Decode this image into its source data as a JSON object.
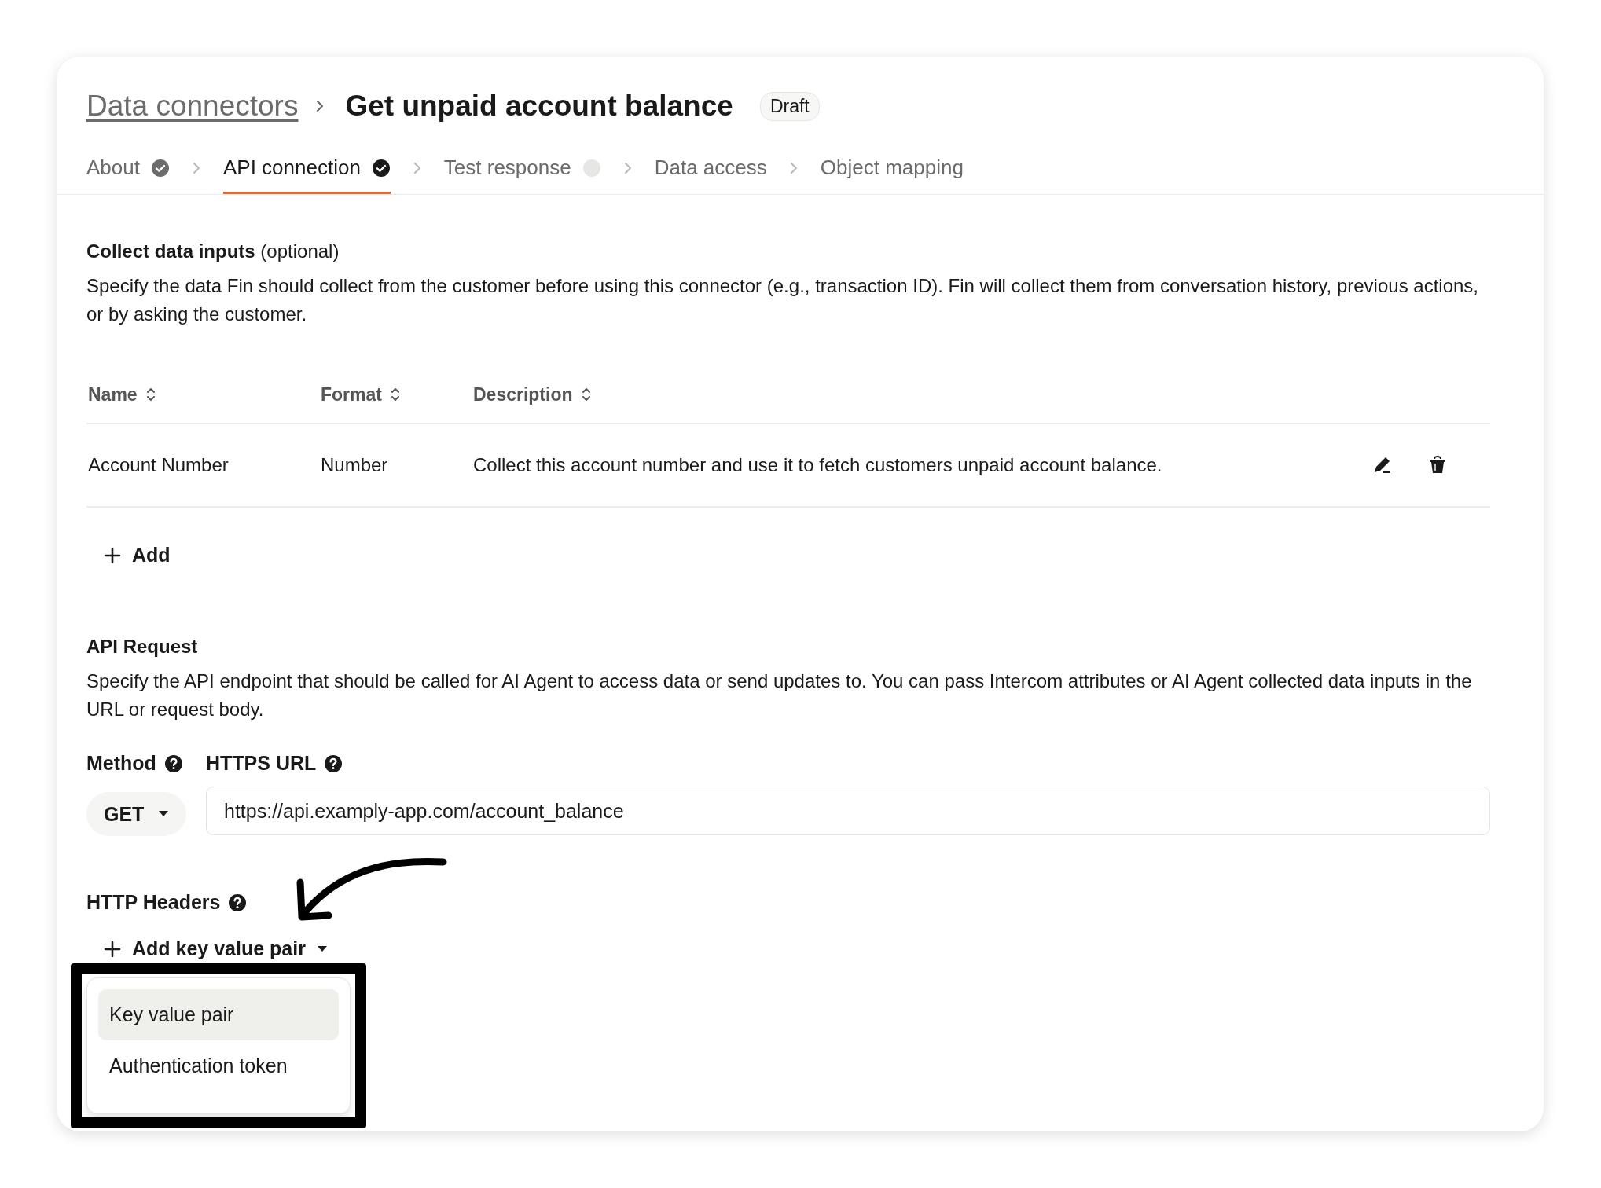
{
  "breadcrumb": {
    "link": "Data connectors",
    "title": "Get unpaid account balance",
    "badge": "Draft"
  },
  "tabs": [
    {
      "label": "About",
      "selected": false,
      "completed": true,
      "pending": false
    },
    {
      "label": "API connection",
      "selected": true,
      "completed": true,
      "pending": false
    },
    {
      "label": "Test response",
      "selected": false,
      "completed": false,
      "pending": true
    },
    {
      "label": "Data access",
      "selected": false,
      "completed": false,
      "pending": false
    },
    {
      "label": "Object mapping",
      "selected": false,
      "completed": false,
      "pending": false
    }
  ],
  "collect_inputs": {
    "title": "Collect data inputs",
    "title_note": "(optional)",
    "description": "Specify the data Fin should collect from the customer before using this connector (e.g., transaction ID). Fin will collect them from conversation history, previous actions, or by asking the customer.",
    "columns": [
      "Name",
      "Format",
      "Description"
    ],
    "rows": [
      {
        "name": "Account Number",
        "format": "Number",
        "description": "Collect this account number and use it to fetch customers unpaid account balance."
      }
    ],
    "add_button": "Add"
  },
  "api_request": {
    "title": "API Request",
    "description": "Specify the API endpoint that should be called for AI Agent to access data or send updates to. You can pass Intercom attributes or AI Agent collected data inputs in the URL or request body.",
    "method_label": "Method",
    "method_value": "GET",
    "url_label": "HTTPS URL",
    "url_value": "https://api.examply-app.com/account_balance"
  },
  "headers": {
    "label": "HTTP Headers",
    "add_button": "Add key value pair",
    "menu": [
      {
        "label": "Key value pair",
        "selected": true
      },
      {
        "label": "Authentication token",
        "selected": false
      }
    ]
  },
  "annotation": {
    "arrow": true,
    "highlight_box": true
  }
}
